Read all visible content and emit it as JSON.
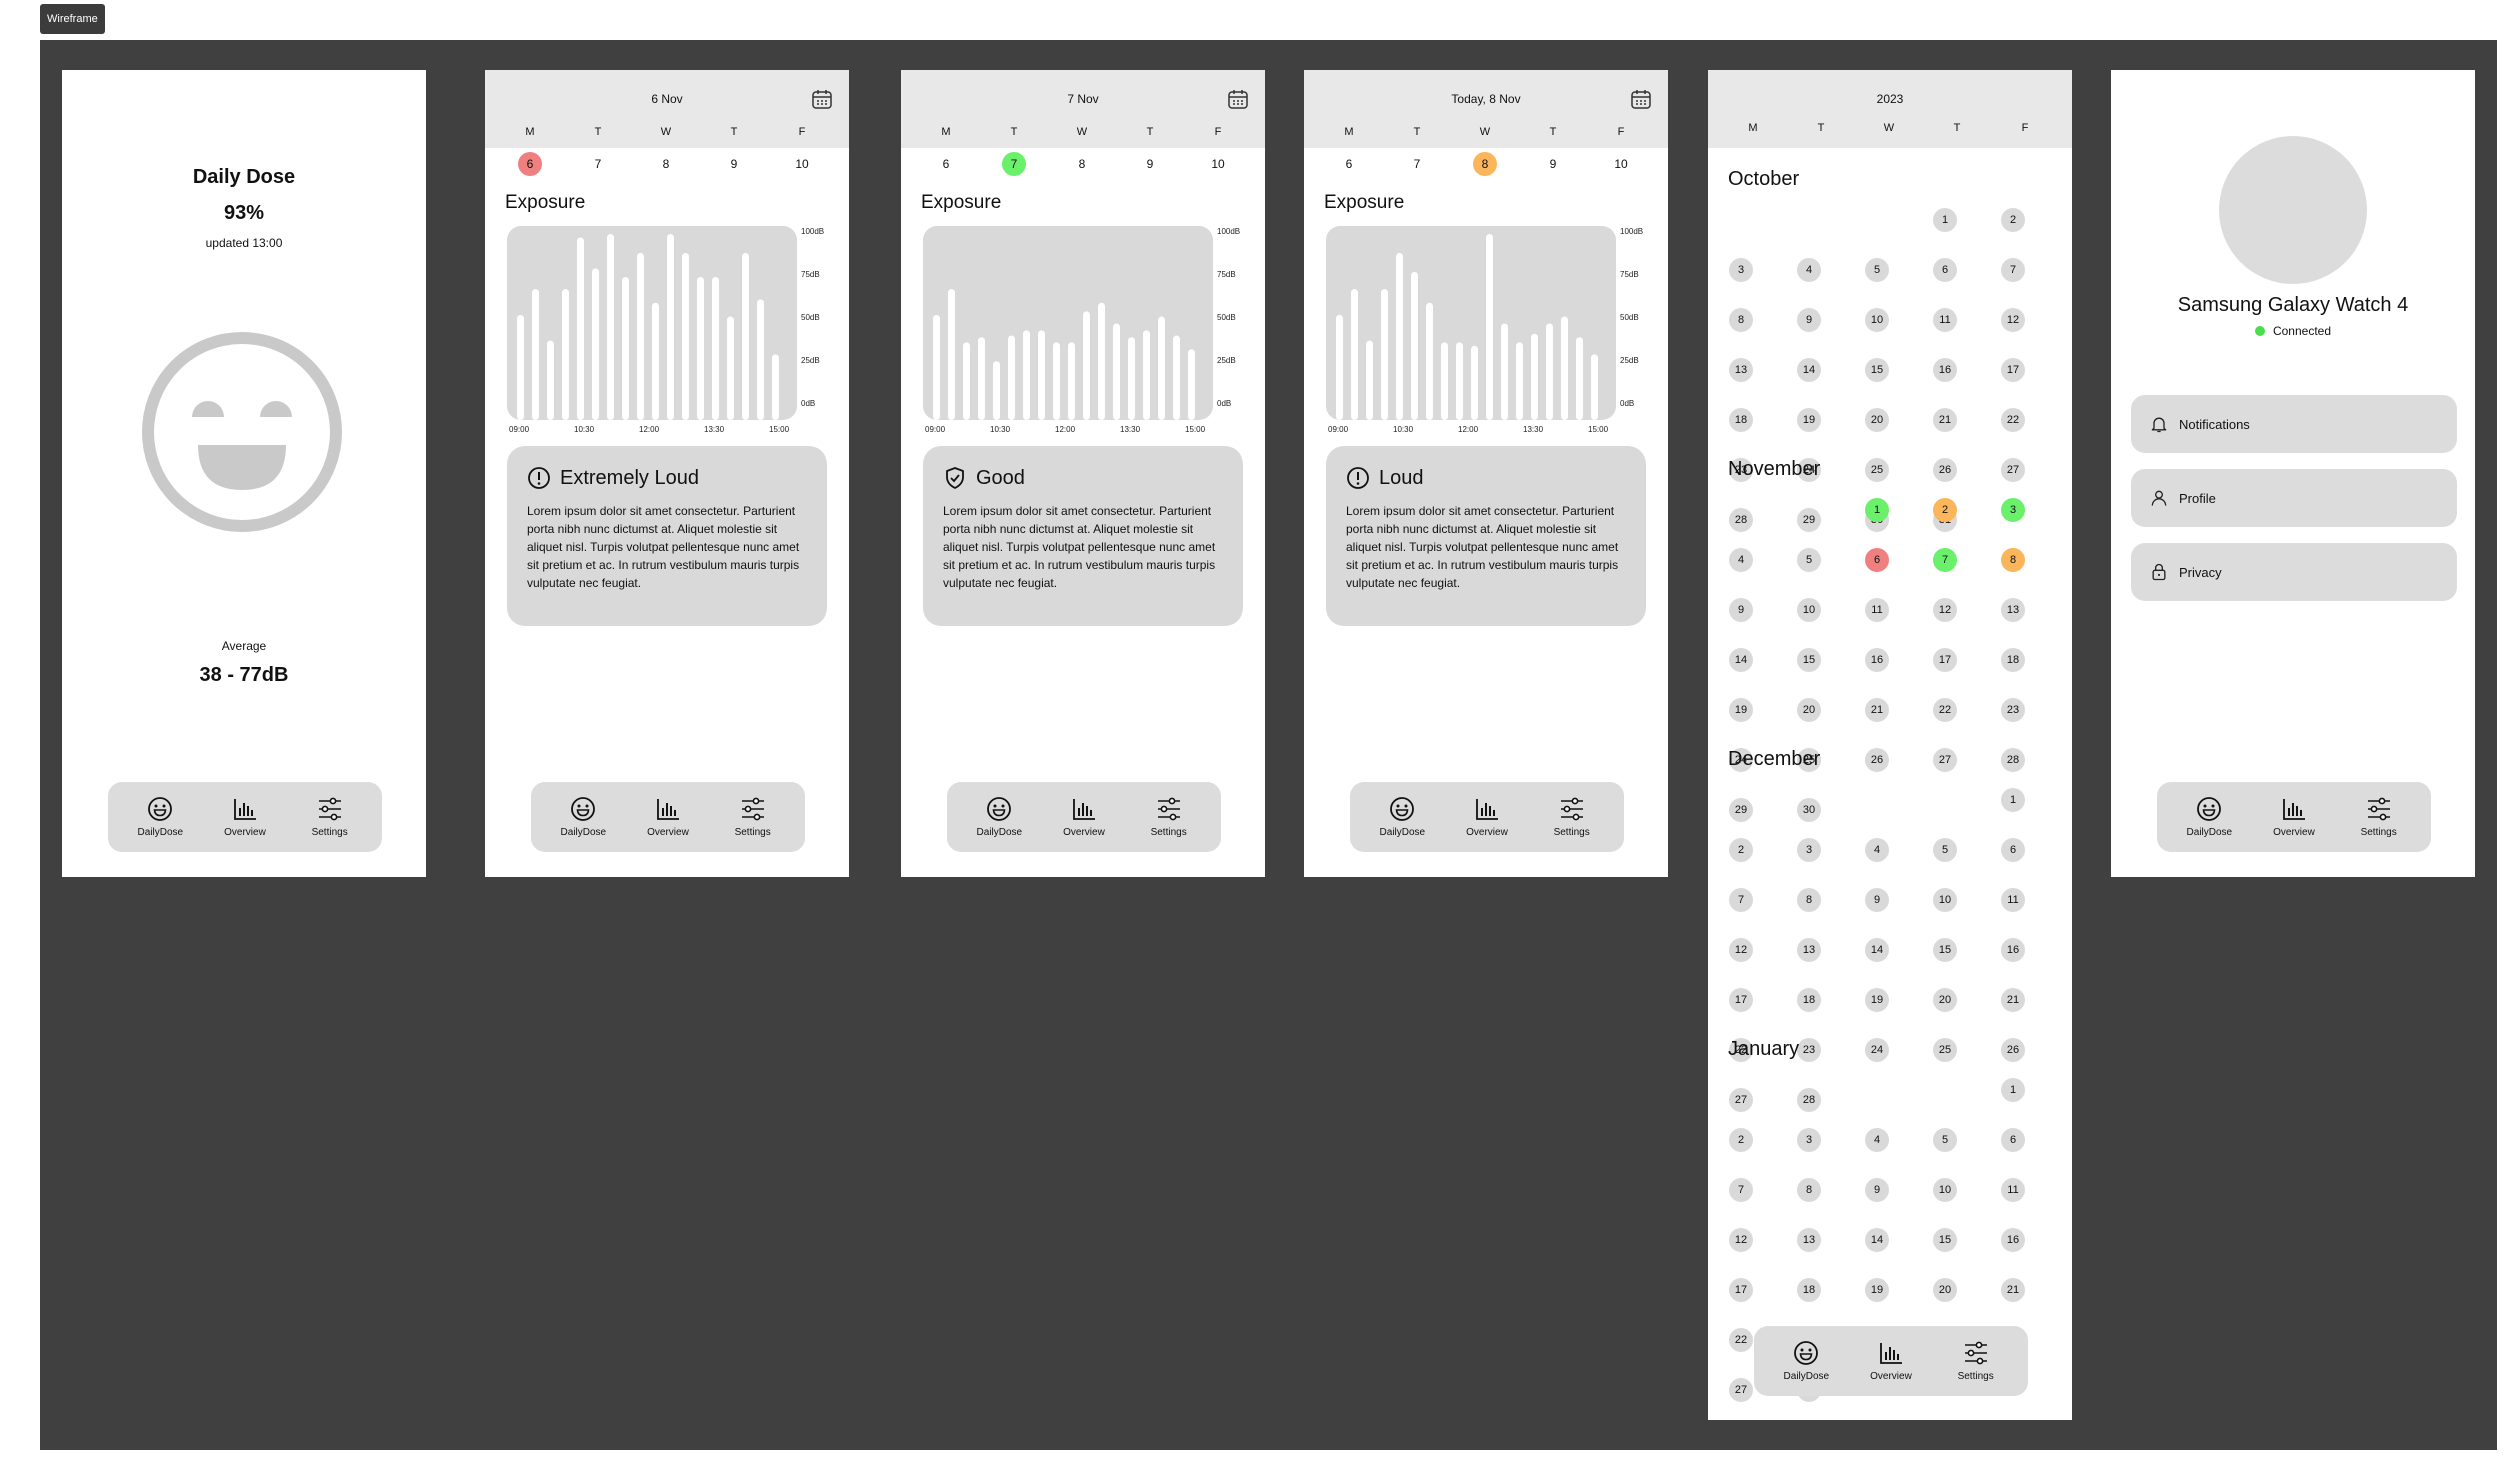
{
  "tag": "Wireframe",
  "nav": {
    "daily": "DailyDose",
    "overview": "Overview",
    "settings": "Settings"
  },
  "dose": {
    "title": "Daily Dose",
    "percent": "93%",
    "updated": "updated 13:00",
    "avg_label": "Average",
    "avg_value": "38 - 77dB"
  },
  "week_labels": [
    "M",
    "T",
    "W",
    "T",
    "F"
  ],
  "week_days": [
    "6",
    "7",
    "8",
    "9",
    "10"
  ],
  "exposure_label": "Exposure",
  "lorem": "Lorem ipsum dolor sit amet consectetur. Parturient porta nibh nunc dictumst at. Aliquet molestie sit aliquet nisl. Turpis volutpat pellentesque nunc amet sit pretium et ac. In rutrum vestibulum mauris turpis vulputate nec feugiat.",
  "screens": [
    {
      "date": "6 Nov",
      "status": "Extremely Loud",
      "selected": "6"
    },
    {
      "date": "7 Nov",
      "status": "Good",
      "selected": "7"
    },
    {
      "date": "Today, 8 Nov",
      "status": "Loud",
      "selected": "8"
    }
  ],
  "colors": {
    "red": "#f08080",
    "green": "#6af06a",
    "orange": "#fbb55a",
    "gray": "#d9d9d9"
  },
  "chart_data": [
    {
      "type": "bar",
      "ylabels": [
        "100dB",
        "75dB",
        "50dB",
        "25dB",
        "0dB"
      ],
      "xlabels": [
        "09:00",
        "10:30",
        "12:00",
        "13:30",
        "15:00"
      ],
      "ylim": [
        0,
        100
      ],
      "values": [
        53,
        68,
        38,
        68,
        98,
        80,
        100,
        75,
        89,
        60,
        100,
        89,
        75,
        75,
        52,
        89,
        62,
        30
      ]
    },
    {
      "type": "bar",
      "ylabels": [
        "100dB",
        "75dB",
        "50dB",
        "25dB",
        "0dB"
      ],
      "xlabels": [
        "09:00",
        "10:30",
        "12:00",
        "13:30",
        "15:00"
      ],
      "ylim": [
        0,
        100
      ],
      "values": [
        53,
        68,
        37,
        40,
        26,
        41,
        44,
        44,
        37,
        37,
        55,
        60,
        48,
        40,
        44,
        52,
        41,
        33
      ]
    },
    {
      "type": "bar",
      "ylabels": [
        "100dB",
        "75dB",
        "50dB",
        "25dB",
        "0dB"
      ],
      "xlabels": [
        "09:00",
        "10:30",
        "12:00",
        "13:30",
        "15:00"
      ],
      "ylim": [
        0,
        100
      ],
      "values": [
        53,
        68,
        38,
        68,
        89,
        78,
        60,
        37,
        37,
        35,
        100,
        48,
        37,
        42,
        48,
        52,
        40,
        30
      ]
    }
  ],
  "year": "2023",
  "months": [
    {
      "name": "October",
      "offset": 0,
      "days": 31
    },
    {
      "name": "November",
      "offset": 2,
      "days": 30
    },
    {
      "name": "December",
      "offset": 4,
      "days": 28
    },
    {
      "name": "January",
      "offset": 4,
      "days": 28
    }
  ],
  "month_highlights": {
    "November": {
      "1": "green",
      "2": "orange",
      "3": "green",
      "6": "red",
      "7": "green",
      "8": "orange"
    }
  },
  "device": {
    "name": "Samsung Galaxy Watch 4",
    "status": "Connected"
  },
  "settings_items": [
    "Notifications",
    "Profile",
    "Privacy"
  ]
}
